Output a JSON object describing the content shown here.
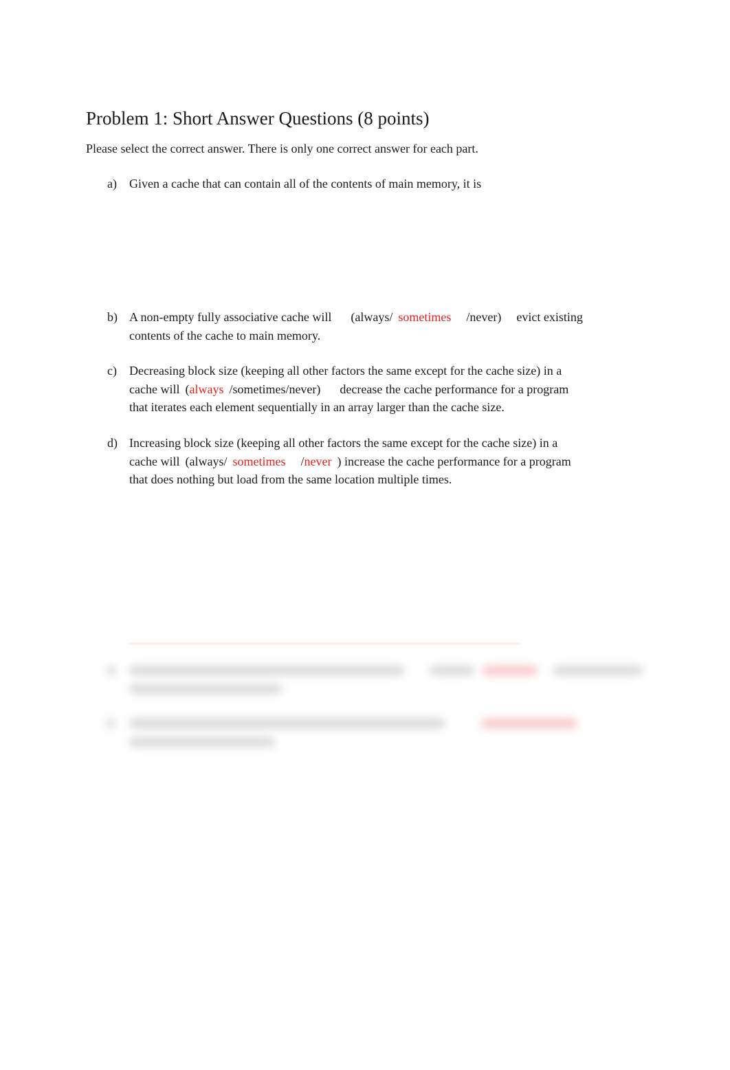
{
  "document": {
    "title": "Problem 1: Short Answer Questions (8 points)",
    "instructions": "Please select the correct answer. There is only one correct answer for each part.",
    "questions": [
      {
        "letter": "a)",
        "text": "Given a cache that can contain all of the contents of main memory, it is"
      },
      {
        "letter": "b)",
        "before": "A non-empty fully associative cache will",
        "opt_open": "(always/",
        "opt_selected": "sometimes",
        "opt_close": "/never)",
        "after_line1": "evict existing",
        "after_line2": "contents of the cache to main memory."
      },
      {
        "letter": "c)",
        "line1": "Decreasing block size (keeping all other factors the same except for the cache size) in a",
        "before": "cache will",
        "opt_open": "(",
        "opt_selected": "always",
        "opt_close": "/sometimes/never)",
        "after_line2": "decrease the cache performance for a program",
        "line3": "that iterates each element sequentially in an array larger than the cache size."
      },
      {
        "letter": "d)",
        "line1": "Increasing block size (keeping all other factors the same except for the cache size) in a",
        "before": "cache will",
        "opt_open": "(always/",
        "opt_selected_1": "sometimes",
        "opt_slash": "/",
        "opt_selected_2": "never",
        "opt_close": ")",
        "after_line2": "increase the cache performance for a program",
        "line3": "that does nothing but load from the same location multiple times."
      }
    ],
    "blurred_section": {
      "note": "remaining questions e) and f) obscured"
    }
  },
  "colors": {
    "answer_highlight": "#e8201c",
    "text": "#1a1a1a"
  }
}
